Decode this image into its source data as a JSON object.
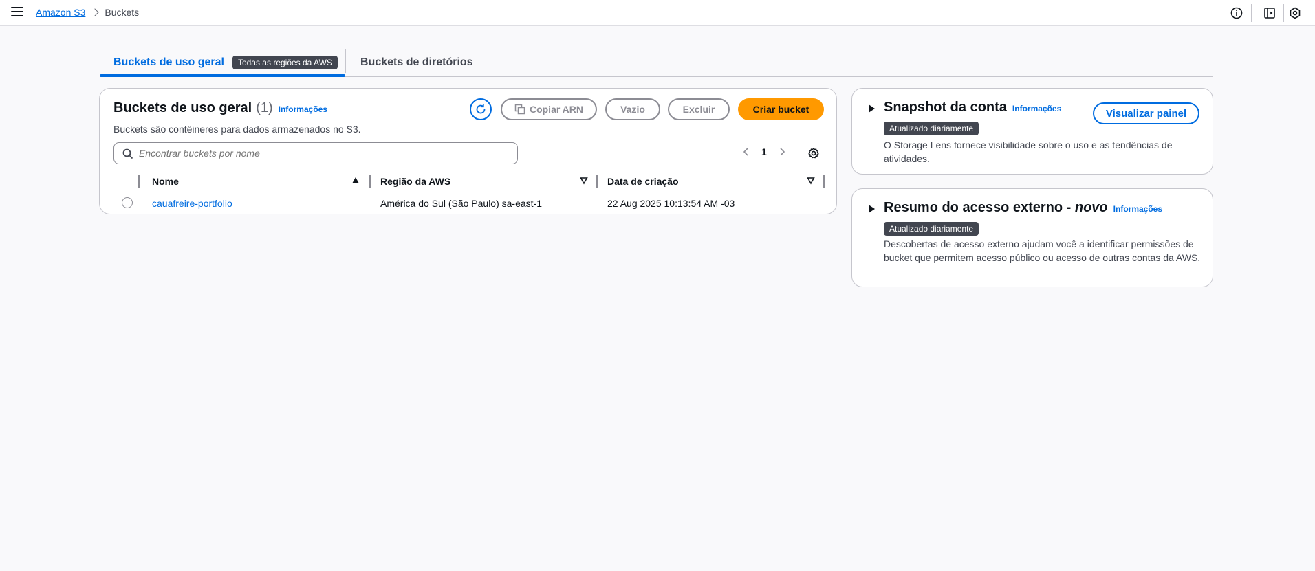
{
  "breadcrumb": {
    "root": "Amazon S3",
    "current": "Buckets"
  },
  "tabs": {
    "general": "Buckets de uso geral",
    "general_badge": "Todas as regiões da AWS",
    "directory": "Buckets de diretórios"
  },
  "buckets_panel": {
    "title": "Buckets de uso geral",
    "count": "(1)",
    "info": "Informações",
    "description": "Buckets são contêineres para dados armazenados no S3.",
    "copy_arn": "Copiar ARN",
    "empty": "Vazio",
    "delete": "Excluir",
    "create": "Criar bucket",
    "search_placeholder": "Encontrar buckets por nome",
    "page": "1",
    "columns": {
      "name": "Nome",
      "region": "Região da AWS",
      "created": "Data de criação"
    },
    "rows": [
      {
        "name": "cauafreire-portfolio",
        "region": "América do Sul (São Paulo) sa-east-1",
        "created": "22 Aug 2025 10:13:54 AM -03"
      }
    ]
  },
  "snapshot_panel": {
    "title": "Snapshot da conta",
    "info": "Informações",
    "badge": "Atualizado diariamente",
    "description": "O Storage Lens fornece visibilidade sobre o uso e as tendências de atividades.",
    "button": "Visualizar painel"
  },
  "external_panel": {
    "title": "Resumo do acesso externo - ",
    "title_new": "novo",
    "info": "Informações",
    "badge": "Atualizado diariamente",
    "description": "Descobertas de acesso externo ajudam você a identificar permissões de bucket que permitem acesso público ou acesso de outras contas da AWS."
  },
  "colors": {
    "accent": "#006ce0",
    "primary_button": "#ff9900",
    "badge_bg": "#424650"
  }
}
